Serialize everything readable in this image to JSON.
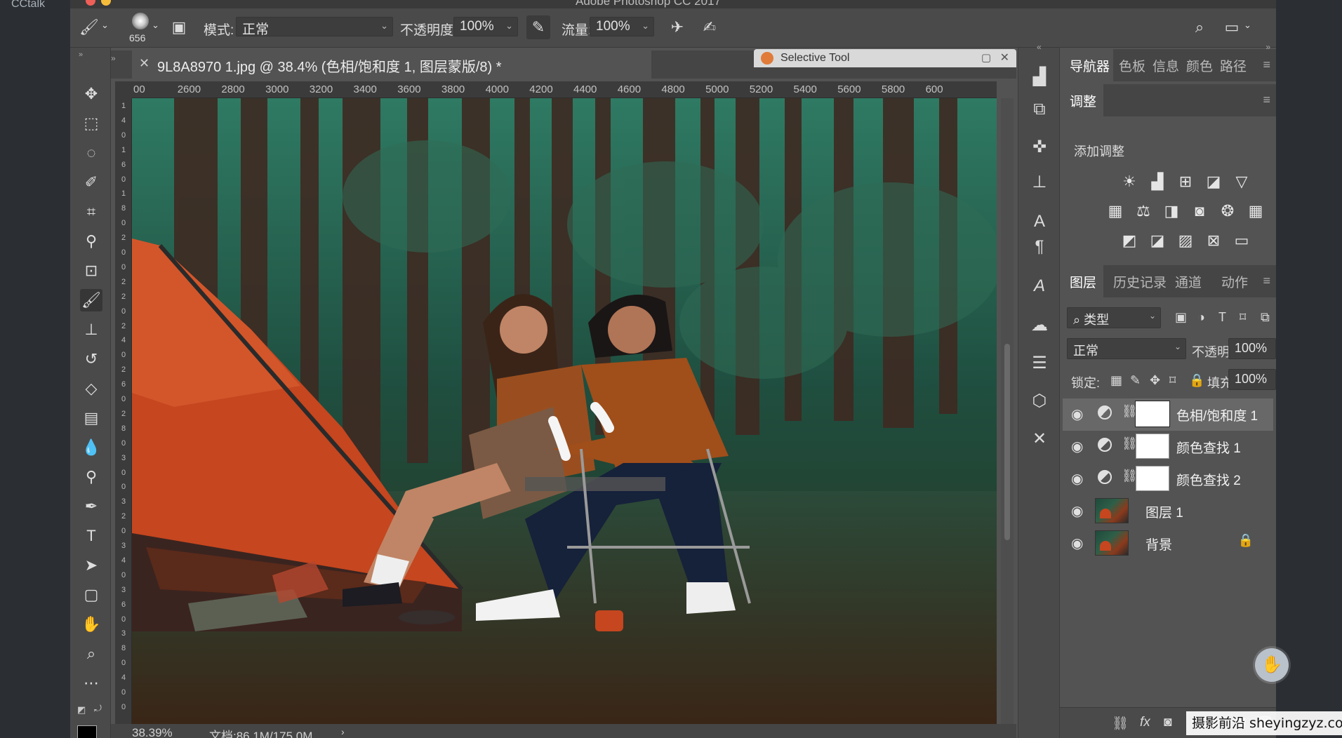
{
  "outer": {
    "left_label": "CCtalk"
  },
  "app": {
    "title": "Adobe Photoshop CC 2017"
  },
  "options_bar": {
    "brush_size": "656",
    "mode_label": "模式:",
    "mode_value": "正常",
    "opacity_label": "不透明度:",
    "opacity_value": "100%",
    "flow_label": "流量:",
    "flow_value": "100%"
  },
  "document": {
    "tab_title": "9L8A8970 1.jpg @ 38.4% (色相/饱和度 1, 图层蒙版/8) *",
    "ruler_ticks": [
      "00",
      "2600",
      "2800",
      "3000",
      "3200",
      "3400",
      "3600",
      "3800",
      "4000",
      "4200",
      "4400",
      "4600",
      "4800",
      "5000",
      "5200",
      "5400",
      "5600",
      "5800",
      "600"
    ],
    "ruler_v_ticks": [
      "1",
      "4",
      "0",
      "1",
      "6",
      "0",
      "1",
      "8",
      "0",
      "2",
      "0",
      "0",
      "2",
      "2",
      "0",
      "2",
      "4",
      "0",
      "2",
      "6",
      "0",
      "2",
      "8",
      "0",
      "3",
      "0",
      "0",
      "3",
      "2",
      "0",
      "3",
      "4",
      "0",
      "3",
      "6",
      "0",
      "3",
      "8",
      "0",
      "4",
      "0",
      "0"
    ],
    "zoom": "38.39%",
    "doc_info": "文档:86.1M/175.0M"
  },
  "floating_panel": {
    "title": "Selective Tool"
  },
  "panels": {
    "nav_tabs": [
      "导航器",
      "色板",
      "信息",
      "颜色",
      "路径"
    ],
    "adjust_tab": "调整",
    "adjust_title": "添加调整",
    "layers_tabs": [
      "图层",
      "历史记录",
      "通道",
      "动作"
    ],
    "filter_kind": "类型",
    "blend_mode": "正常",
    "opacity_label": "不透明度:",
    "opacity_value": "100%",
    "lock_label": "锁定:",
    "fill_label": "填充:",
    "fill_value": "100%",
    "layers": [
      {
        "name": "色相/饱和度 1",
        "type": "adjustment",
        "selected": true
      },
      {
        "name": "颜色查找 1",
        "type": "adjustment",
        "selected": false
      },
      {
        "name": "颜色查找 2",
        "type": "adjustment",
        "selected": false
      },
      {
        "name": "图层 1",
        "type": "pixel",
        "selected": false
      },
      {
        "name": "背景",
        "type": "background",
        "selected": false,
        "locked": true
      }
    ],
    "bottom_fx": "fx"
  },
  "watermark": "摄影前沿 sheyingzyz.com",
  "colors": {
    "canvas_forest": "#1d3a30",
    "tent": "#c5461f",
    "panel_bg": "#535353",
    "selected_layer": "#686868"
  }
}
